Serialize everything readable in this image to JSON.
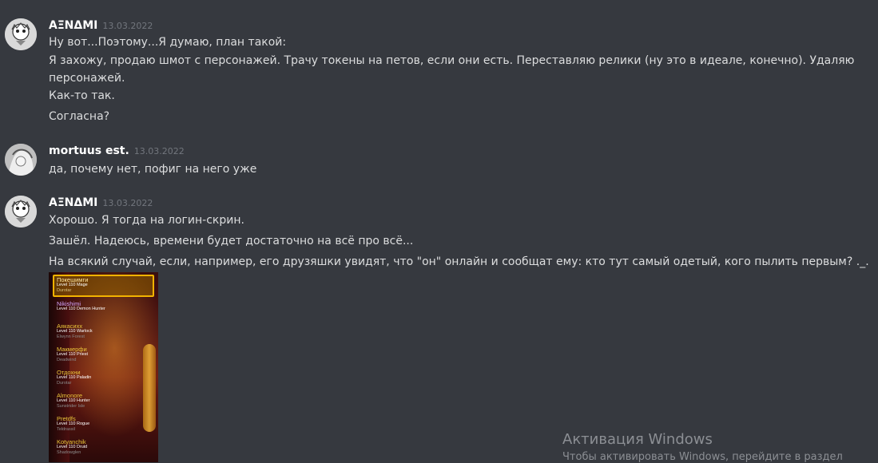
{
  "messages": [
    {
      "author": "ΑΞΝΔΜΙ",
      "timestamp": "13.03.2022",
      "lines": [
        "Ну вот...Поэтому...Я думаю, план такой:",
        "Я захожу, продаю шмот с персонажей. Трачу токены на петов, если они есть. Переставляю релики (ну это в идеале, конечно). Удаляю",
        "персонажей.",
        "Как-то так.",
        "Согласна?"
      ]
    },
    {
      "author": "mortuus est.",
      "timestamp": "13.03.2022",
      "lines": [
        "да, почему нет, пофиг на него уже"
      ]
    },
    {
      "author": "ΑΞΝΔΜΙ",
      "timestamp": "13.03.2022",
      "lines": [
        "Хорошо. Я тогда на логин-скрин.",
        "Зашёл. Надеюсь, времени будет достаточно на всё про всё...",
        "На всякий случай, если, например, его друзяшки увидят, что \"он\" онлайн и сообщат ему: кто тут самый одетый, кого пылить первым? ._."
      ]
    }
  ],
  "attachment": {
    "characters": [
      {
        "name": "Покешимги",
        "level": "Level 110 Mage",
        "zone": "Durotar"
      },
      {
        "name": "Nikishimi",
        "level": "Level 110 Demon Hunter",
        "zone": ""
      },
      {
        "name": "Аякасихх",
        "level": "Level 110 Warlock",
        "zone": "Elwynn Forest"
      },
      {
        "name": "Макмерфи",
        "level": "Level 110 Priest",
        "zone": "Deadwind"
      },
      {
        "name": "Отдохни",
        "level": "Level 110 Paladin",
        "zone": "Durotar"
      },
      {
        "name": "Almonore",
        "level": "Level 110 Hunter",
        "zone": "Sunstrider Isle"
      },
      {
        "name": "Pretdfs",
        "level": "Level 110 Rogue",
        "zone": "Teldrassil"
      },
      {
        "name": "Kotyanchik",
        "level": "Level 110 Druid",
        "zone": "Shadowglen"
      }
    ]
  },
  "activation": {
    "title": "Активация Windows",
    "subtitle": "Чтобы активировать Windows, перейдите в раздел"
  }
}
